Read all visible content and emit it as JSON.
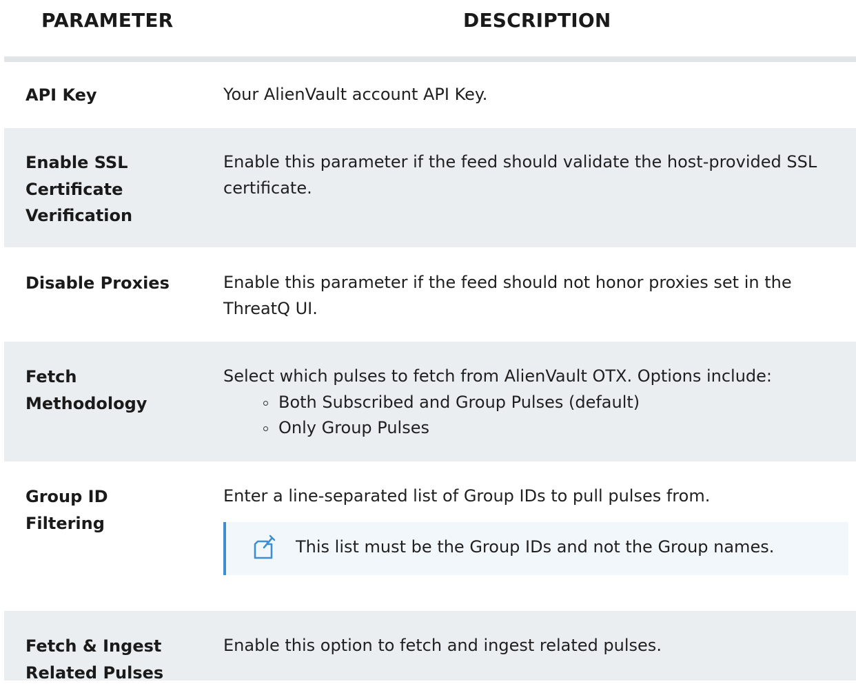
{
  "header": {
    "parameter": "PARAMETER",
    "description": "DESCRIPTION"
  },
  "rows": [
    {
      "parameter": "API Key",
      "description": "Your AlienVault account API Key."
    },
    {
      "parameter": "Enable SSL Certificate Verification",
      "description": "Enable this parameter if the feed should validate the host-provided SSL certificate."
    },
    {
      "parameter": "Disable Proxies",
      "description": "Enable this parameter if the feed should not honor proxies set in the ThreatQ UI."
    },
    {
      "parameter": "Fetch Methodology",
      "description": "Select which pulses to fetch from AlienVault OTX. Options include:",
      "options": [
        "Both Subscribed and Group Pulses (default)",
        "Only Group Pulses"
      ]
    },
    {
      "parameter": "Group ID Filtering",
      "description": "Enter a line-separated list of Group IDs to pull pulses from.",
      "note": {
        "icon": "note-icon",
        "text": "This list must be the Group IDs and not the Group names."
      }
    },
    {
      "parameter": "Fetch & Ingest Related Pulses",
      "description": "Enable this option to fetch and ingest related pulses."
    }
  ],
  "colors": {
    "row_shade": "#ebeef0",
    "note_bg": "#f2f7fb",
    "note_accent": "#3d8fd1"
  }
}
